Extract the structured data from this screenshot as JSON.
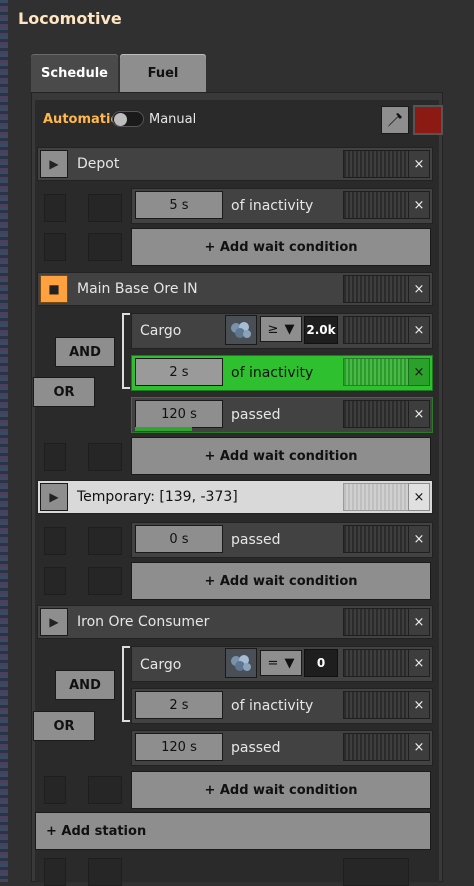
{
  "window": {
    "title": "Locomotive"
  },
  "tabs": [
    {
      "label": "Schedule"
    },
    {
      "label": "Fuel"
    }
  ],
  "mode": {
    "automatic_label": "Automatic",
    "manual_label": "Manual"
  },
  "stations": [
    {
      "name": "Depot",
      "conditions": [
        {
          "value": "5 s",
          "label": "of inactivity"
        }
      ]
    },
    {
      "name": "Main Base Ore IN",
      "conditions": [
        {
          "type": "cargo",
          "label": "Cargo",
          "comparator": "≥",
          "amount": "2.0k"
        },
        {
          "value": "2 s",
          "label": "of inactivity"
        },
        {
          "value": "120 s",
          "label": "passed"
        }
      ],
      "logic": [
        "AND",
        "OR"
      ]
    },
    {
      "name": "Temporary: [139, -373]",
      "conditions": [
        {
          "value": "0 s",
          "label": "passed"
        }
      ]
    },
    {
      "name": "Iron Ore Consumer",
      "conditions": [
        {
          "type": "cargo",
          "label": "Cargo",
          "comparator": "=",
          "amount": "0"
        },
        {
          "value": "2 s",
          "label": "of inactivity"
        },
        {
          "value": "120 s",
          "label": "passed"
        }
      ],
      "logic": [
        "AND",
        "OR"
      ]
    }
  ],
  "add_wait_label": "+ Add wait condition",
  "add_station_label": "+ Add station",
  "close_glyph": "×",
  "colors": {
    "active_station": "#ffa13e",
    "active_condition": "#2fc02f",
    "accent": "#ffb84a",
    "train_color": "#8b1a14"
  },
  "icons": {
    "play": "play-icon",
    "stop": "stop-icon",
    "color_picker": "eyedropper-icon",
    "item": "iron-ore-icon"
  }
}
